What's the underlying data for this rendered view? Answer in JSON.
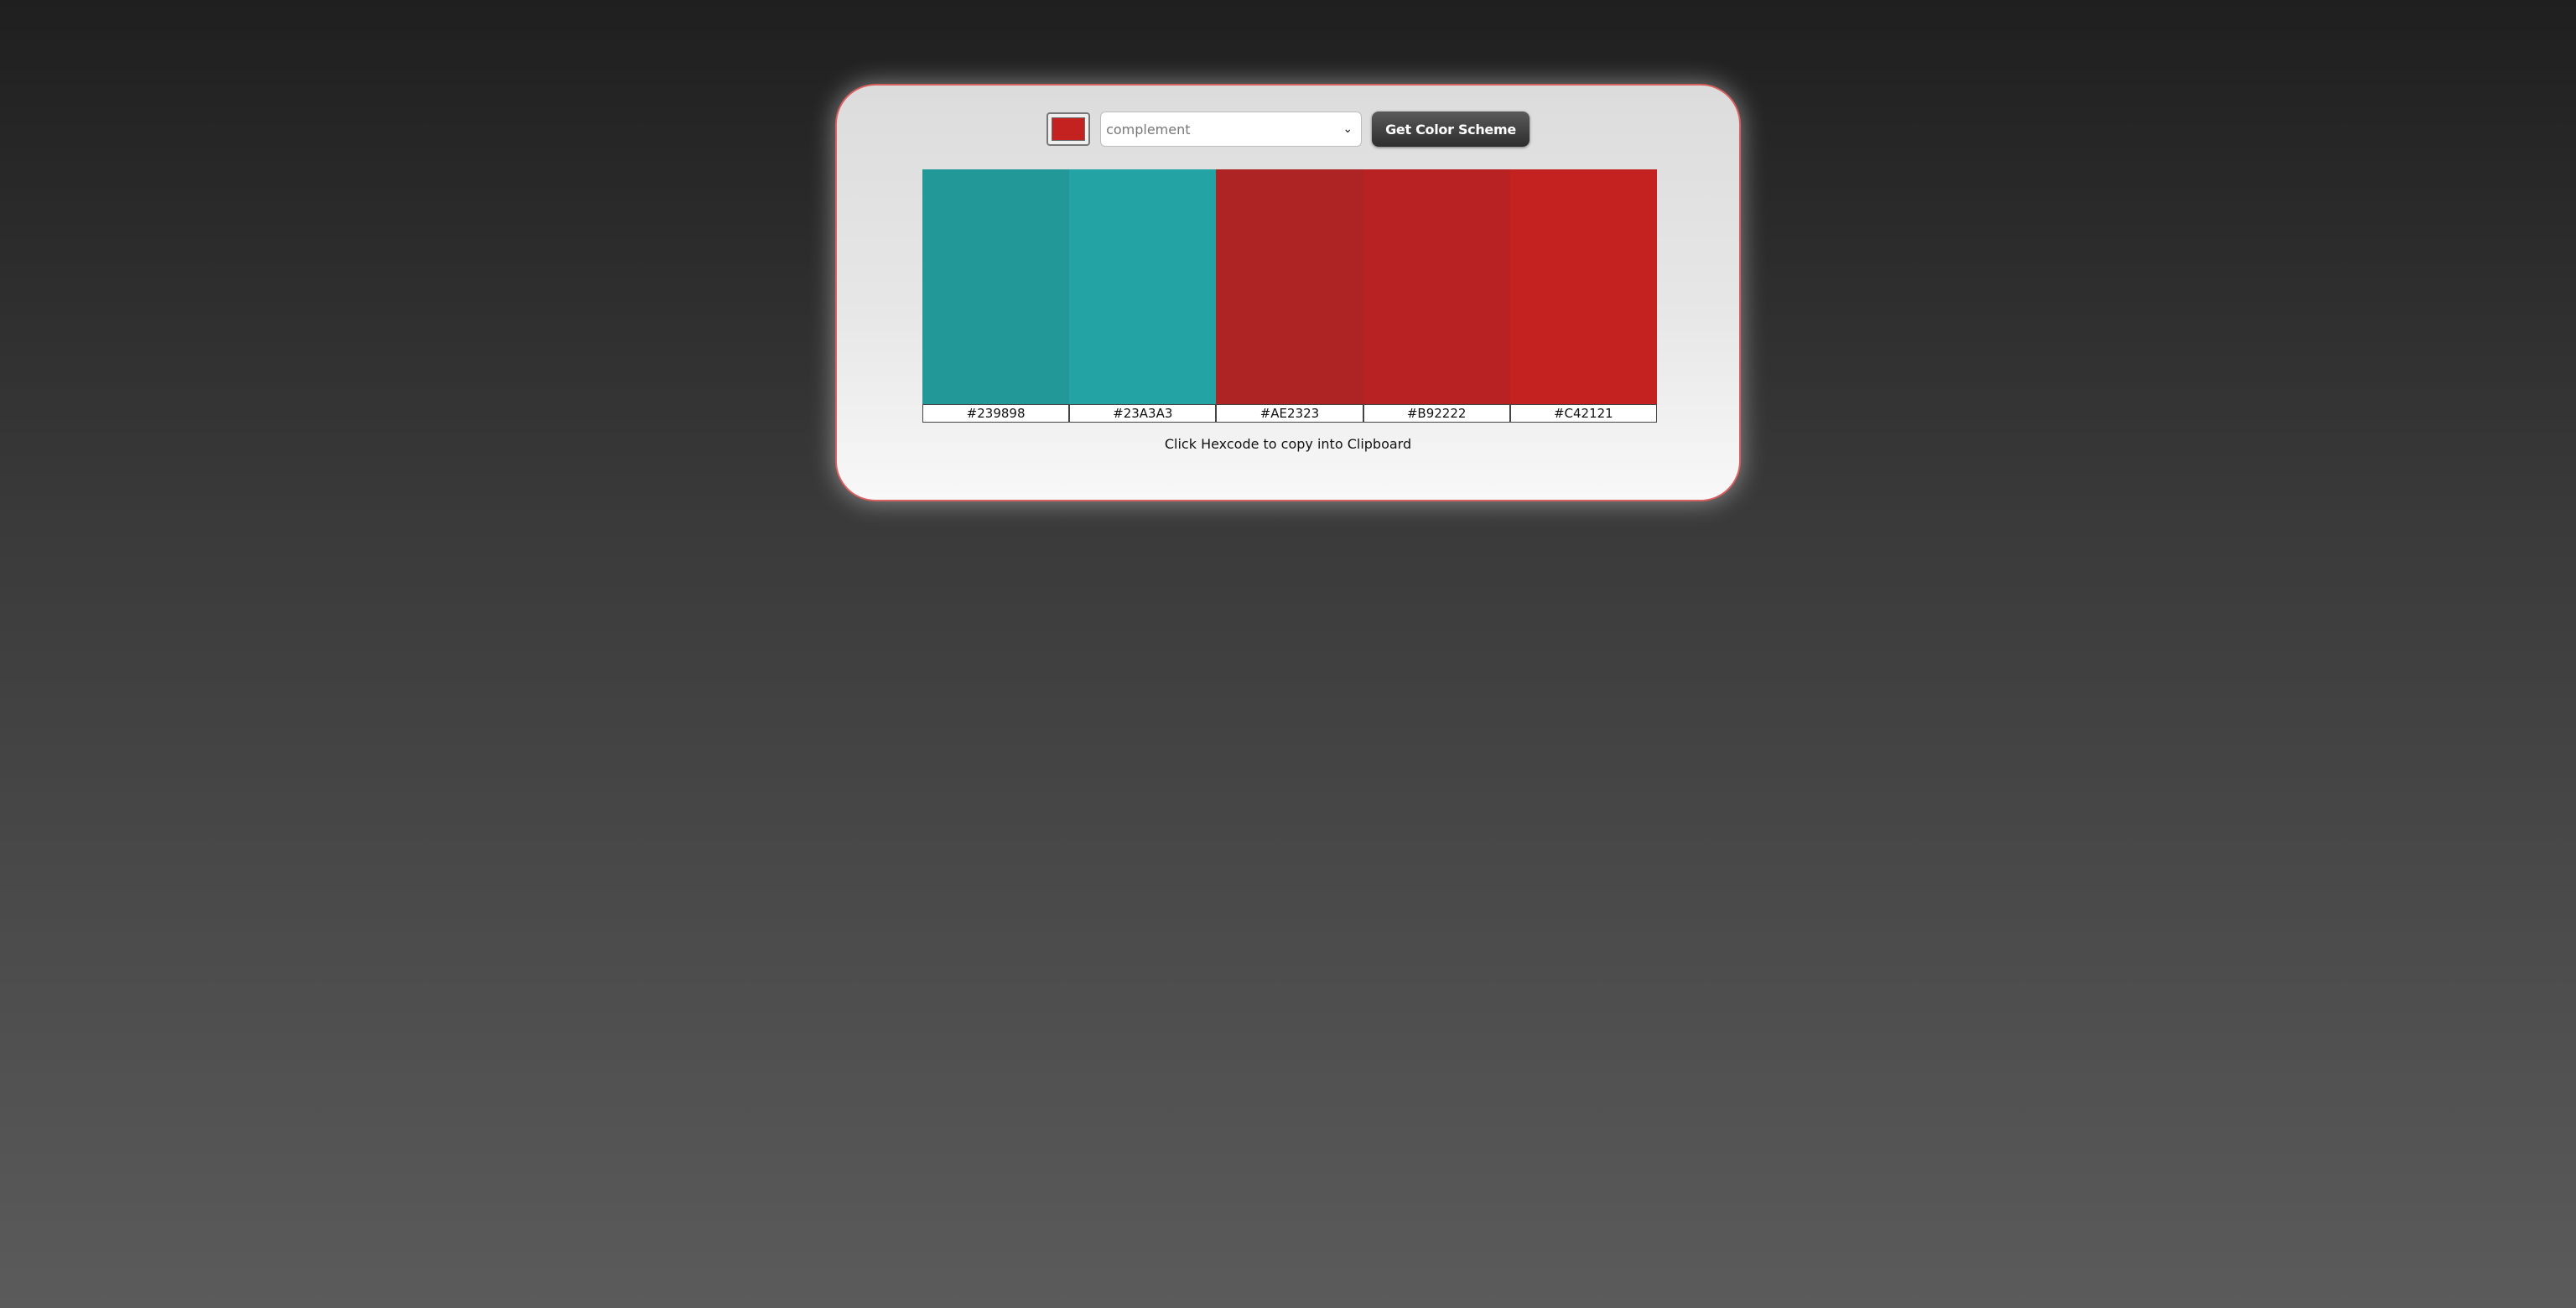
{
  "seed_color": "#C42121",
  "mode_select": {
    "selected": "complement"
  },
  "get_button_label": "Get Color Scheme",
  "colors": [
    {
      "hex": "#239898",
      "label": "#239898"
    },
    {
      "hex": "#23A3A3",
      "label": "#23A3A3"
    },
    {
      "hex": "#AE2323",
      "label": "#AE2323"
    },
    {
      "hex": "#B92222",
      "label": "#B92222"
    },
    {
      "hex": "#C42121",
      "label": "#C42121"
    }
  ],
  "hint": "Click Hexcode to copy into Clipboard",
  "icons": {
    "select_arrow": "chevron-down-icon"
  }
}
